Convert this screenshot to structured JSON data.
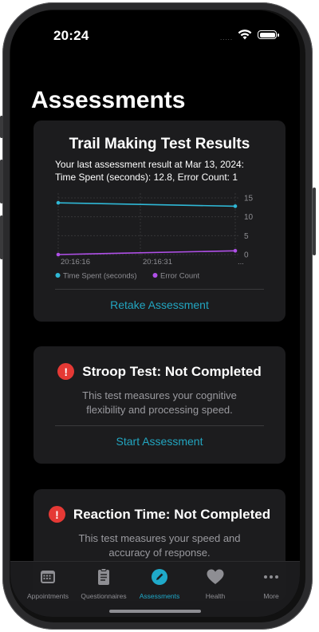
{
  "status_bar": {
    "time": "20:24",
    "signal": "....."
  },
  "page": {
    "title": "Assessments"
  },
  "trail_card": {
    "title": "Trail Making Test Results",
    "result_line1": "Your last assessment result at Mar 13, 2024:",
    "result_line2": "Time Spent (seconds): 12.8, Error Count: 1",
    "action": "Retake Assessment"
  },
  "chart_data": {
    "type": "line",
    "x": [
      "20:16:16",
      "20:16:31",
      "..."
    ],
    "y_ticks": [
      15,
      10,
      5,
      0
    ],
    "ylim": [
      0,
      15
    ],
    "series": [
      {
        "name": "Time Spent (seconds)",
        "values": [
          13.7,
          12.8
        ],
        "color": "#2fb8d6"
      },
      {
        "name": "Error Count",
        "values": [
          0,
          1
        ],
        "color": "#b050e8"
      }
    ],
    "legend_position": "bottom-left"
  },
  "stroop_card": {
    "title": "Stroop Test: Not Completed",
    "desc_line1": "This test measures your cognitive",
    "desc_line2": "flexibility and processing speed.",
    "action": "Start Assessment",
    "icon": "exclamation-icon"
  },
  "reaction_card": {
    "title": "Reaction Time: Not Completed",
    "desc_line1": "This test measures your speed and",
    "desc_line2": "accuracy of response.",
    "icon": "exclamation-icon"
  },
  "tabbar": {
    "items": [
      {
        "label": "Appointments",
        "icon": "calendar-icon"
      },
      {
        "label": "Questionnaires",
        "icon": "clipboard-icon"
      },
      {
        "label": "Assessments",
        "icon": "pencil-icon",
        "active": true
      },
      {
        "label": "Health",
        "icon": "heart-icon"
      },
      {
        "label": "More",
        "icon": "ellipsis-icon"
      }
    ]
  },
  "colors": {
    "accent": "#1fa9c9",
    "warning": "#e53935",
    "card": "#1c1c1e"
  }
}
